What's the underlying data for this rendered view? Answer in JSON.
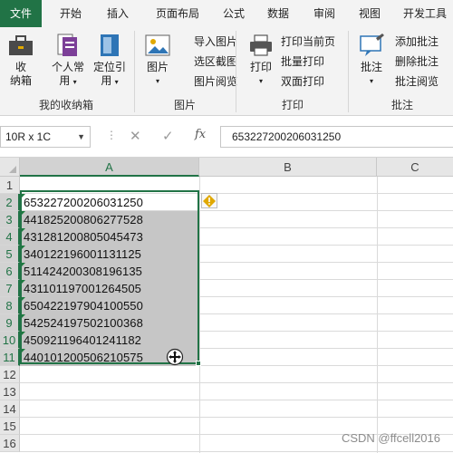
{
  "tabs": [
    "文件",
    "开始",
    "插入",
    "页面布局",
    "公式",
    "数据",
    "审阅",
    "视图",
    "开发工具"
  ],
  "active_tab": "文件",
  "ribbon": {
    "group_storage": {
      "label": "我的收纳箱",
      "btn_storage_1": "收",
      "btn_storage_2": "纳箱",
      "btn_personal_1": "个人常",
      "btn_personal_2": "用",
      "btn_locate_1": "定位引",
      "btn_locate_2": "用"
    },
    "group_picture": {
      "label": "图片",
      "btn_picture": "图片",
      "btn_import": "导入图片",
      "btn_area_capture": "选区截图",
      "btn_picture_view": "图片阅览"
    },
    "group_print": {
      "label": "打印",
      "btn_print": "打印",
      "btn_print_page": "打印当前页",
      "btn_batch_print": "批量打印",
      "btn_duplex_print": "双面打印"
    },
    "group_comment": {
      "label": "批注",
      "btn_comment": "批注",
      "btn_add": "添加批注",
      "btn_delete": "删除批注",
      "btn_browse": "批注阅览"
    }
  },
  "formula_bar": {
    "name_box": "10R x 1C",
    "dots": "⋮",
    "cancel_icon": "✕",
    "confirm_icon": "✓",
    "fx": "fx",
    "value": "653227200206031250"
  },
  "columns": [
    "A",
    "B",
    "C"
  ],
  "rows": [
    "1",
    "2",
    "3",
    "4",
    "5",
    "6",
    "7",
    "8",
    "9",
    "10",
    "11",
    "12",
    "13",
    "14",
    "15",
    "16"
  ],
  "cells": [
    "653227200206031250",
    "441825200806277528",
    "431281200805045473",
    "340122196001131125",
    "511424200308196135",
    "431101197001264505",
    "650422197904100550",
    "542524197502100368",
    "450921196401241182",
    "440101200506210575"
  ],
  "watermark": "CSDN @ffcell2016",
  "colors": {
    "accent": "#217346",
    "selection_fill": "#c6c6c6",
    "error_flag": "#1d7a3e",
    "warning_icon": "#e0a800"
  }
}
